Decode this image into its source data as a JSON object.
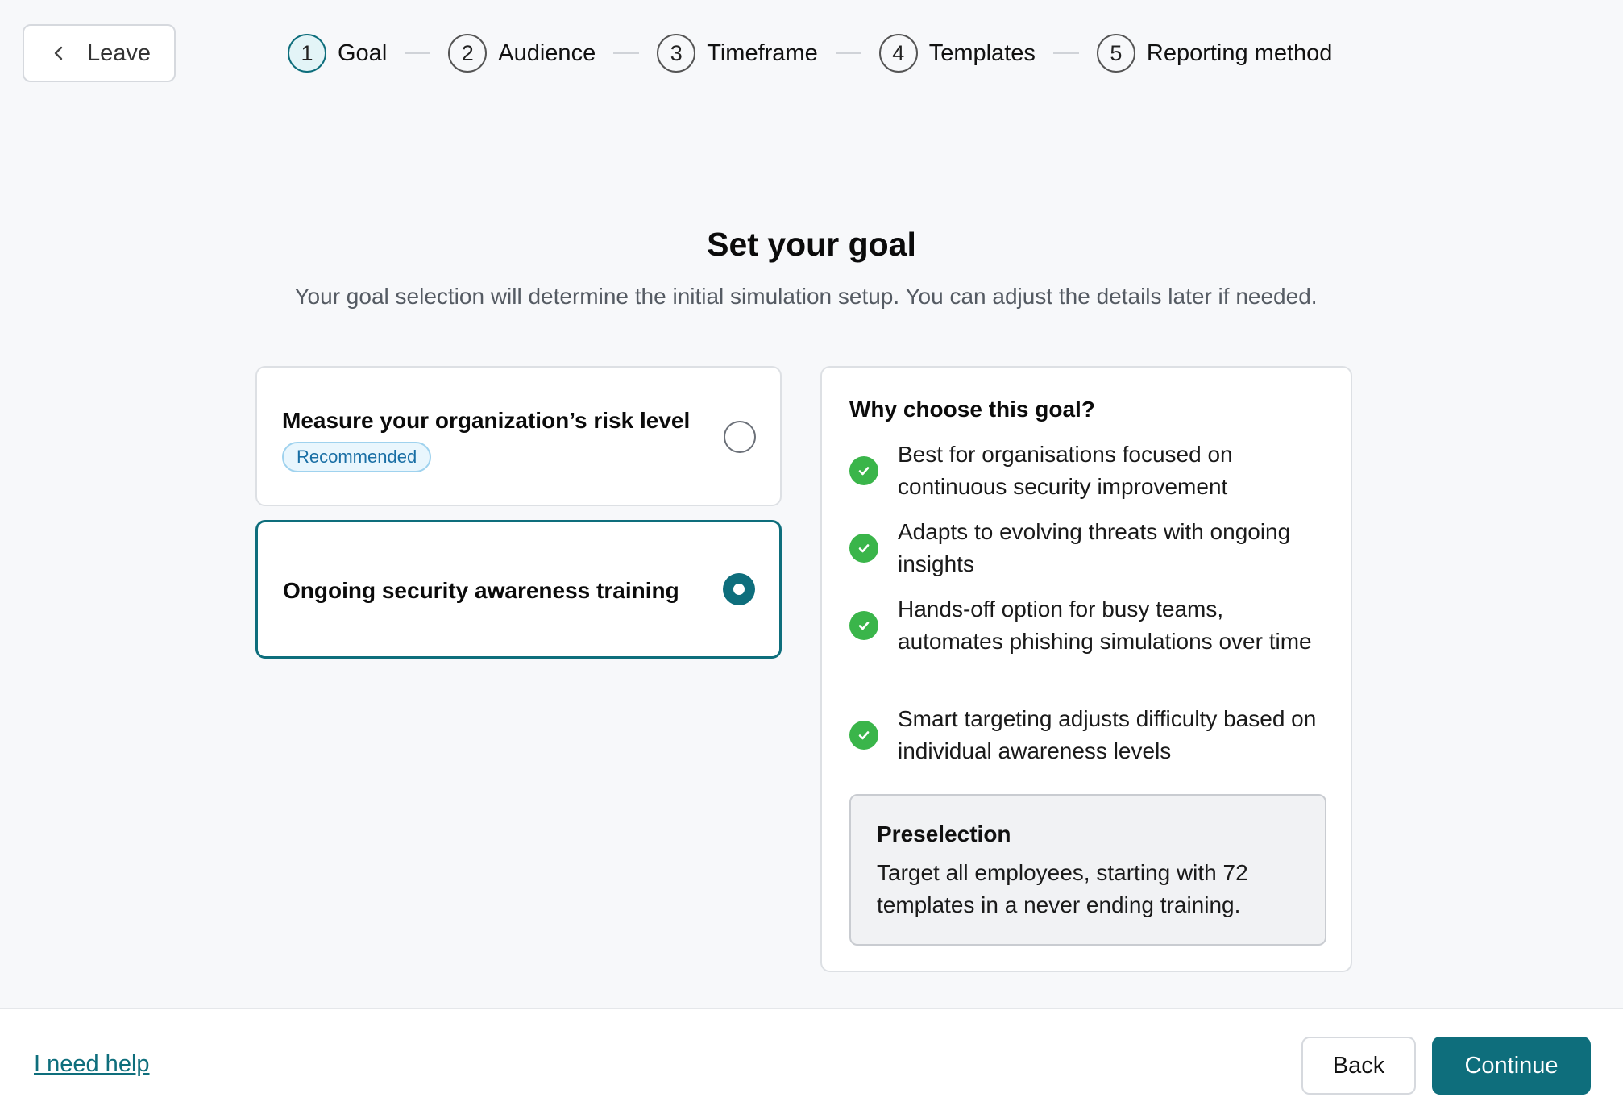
{
  "header": {
    "leave_label": "Leave",
    "steps": [
      {
        "number": "1",
        "label": "Goal",
        "active": true
      },
      {
        "number": "2",
        "label": "Audience",
        "active": false
      },
      {
        "number": "3",
        "label": "Timeframe",
        "active": false
      },
      {
        "number": "4",
        "label": "Templates",
        "active": false
      },
      {
        "number": "5",
        "label": "Reporting method",
        "active": false
      }
    ]
  },
  "main": {
    "title": "Set your goal",
    "subtitle": "Your goal selection will determine the initial simulation setup. You can adjust the details later if needed.",
    "options": [
      {
        "title": "Measure your organization’s risk level",
        "badge": "Recommended",
        "selected": false
      },
      {
        "title": "Ongoing security awareness training",
        "selected": true
      }
    ],
    "why": {
      "title": "Why choose this goal?",
      "benefits": [
        "Best for organisations focused on continuous security improvement",
        "Adapts to evolving threats with ongoing insights",
        "Hands-off option for busy teams, automates phishing simulations over time",
        "Smart targeting adjusts difficulty based on individual awareness levels"
      ],
      "preselection_title": "Preselection",
      "preselection_text": "Target all employees, starting with 72 templates in a never ending training."
    }
  },
  "footer": {
    "help_label": "I need help",
    "back_label": "Back",
    "continue_label": "Continue"
  },
  "colors": {
    "accent": "#0e6e7c",
    "success": "#3ab54a",
    "badge_text": "#1a6fa5"
  }
}
